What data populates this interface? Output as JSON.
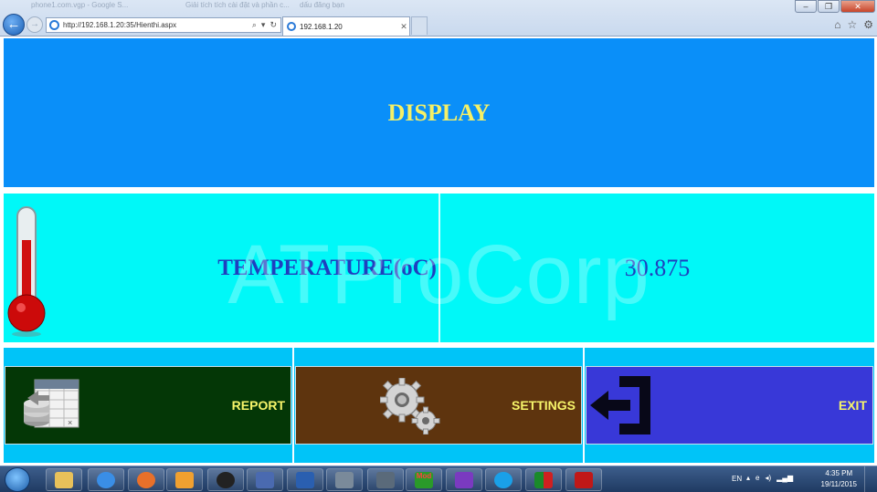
{
  "browser": {
    "background_tabs": [
      "phone1.com.vgp - Google S...",
      "Giải tích tích cài đặt và phần c...",
      "dấu đăng bạn"
    ],
    "window_controls": {
      "minimize": "–",
      "restore": "❐",
      "close": "✕"
    },
    "address": {
      "value": "http://192.168.1.20:35/Hienthi.aspx",
      "search_glyph": "⌕",
      "dropdown_glyph": "▾",
      "refresh_glyph": "↻"
    },
    "active_tab": {
      "title": "192.168.1.20",
      "close_glyph": "✕"
    },
    "toolbar_icons": [
      "home-icon",
      "star-icon",
      "gear-icon"
    ]
  },
  "page": {
    "display_title": "DISPLAY",
    "temperature_label": "TEMPERATURE(oC)",
    "temperature_value": "30.875",
    "watermark": "ATProCorp",
    "buttons": {
      "report": "REPORT",
      "settings": "SETTINGS",
      "exit": "EXIT"
    },
    "colors": {
      "display_bg": "#0a8ff9",
      "title_text": "#f5f067",
      "temperature_bg": "#00f8f8",
      "temperature_text": "#1f3fbf",
      "button_bar_bg": "#00c4f8",
      "report_bg": "#043706",
      "settings_bg": "#5e340e",
      "exit_bg": "#3838d8",
      "button_text": "#f7f56a"
    }
  },
  "taskbar": {
    "apps": [
      "explorer-icon",
      "internet-explorer-icon",
      "firefox-icon",
      "media-player-icon",
      "app-icon",
      "network-icon",
      "outlook-icon",
      "lock-icon",
      "sql-icon",
      "modbus-icon",
      "visual-studio-icon",
      "skype-icon",
      "flag-icon",
      "acrobat-icon"
    ],
    "modbus_label": "Mod",
    "tray": {
      "language": "EN",
      "time": "4:35 PM",
      "date": "19/11/2015"
    }
  }
}
